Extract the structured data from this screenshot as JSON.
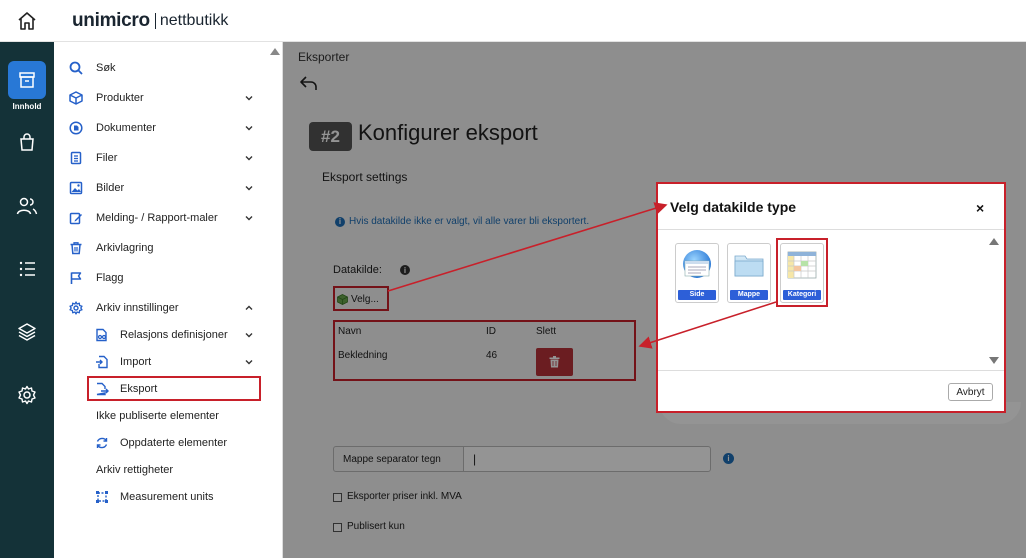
{
  "brand": {
    "name": "unimicro",
    "product": "nettbutikk"
  },
  "rail": {
    "active_label": "Innhold"
  },
  "sidenav": {
    "items": [
      {
        "label": "Søk"
      },
      {
        "label": "Produkter"
      },
      {
        "label": "Dokumenter"
      },
      {
        "label": "Filer"
      },
      {
        "label": "Bilder"
      },
      {
        "label": "Melding- / Rapport-maler"
      },
      {
        "label": "Arkivlagring"
      },
      {
        "label": "Flagg"
      },
      {
        "label": "Arkiv innstillinger"
      }
    ],
    "sub_items": [
      {
        "label": "Relasjons definisjoner"
      },
      {
        "label": "Import"
      },
      {
        "label": "Eksport"
      },
      {
        "label": "Ikke publiserte elementer"
      },
      {
        "label": "Oppdaterte elementer"
      },
      {
        "label": "Arkiv rettigheter"
      },
      {
        "label": "Measurement units"
      }
    ]
  },
  "main": {
    "breadcrumb": "Eksporter",
    "step": "#2",
    "title": "Konfigurer eksport",
    "section_title": "Eksport settings",
    "info_text": "Hvis datakilde ikke er valgt, vil alle varer bli eksportert.",
    "datasource_label": "Datakilde:",
    "velg_label": "Velg...",
    "table": {
      "headers": [
        "Navn",
        "ID",
        "Slett"
      ],
      "rows": [
        {
          "navn": "Bekledning",
          "id": "46"
        }
      ]
    },
    "separator_label": "Mappe separator tegn",
    "separator_value": "|",
    "checkbox_prices": "Eksporter priser inkl. MVA",
    "checkbox_published": "Publisert kun"
  },
  "dialog": {
    "title": "Velg datakilde type",
    "close": "×",
    "tiles": [
      {
        "label": "Side"
      },
      {
        "label": "Mappe"
      },
      {
        "label": "Kategori"
      }
    ],
    "cancel": "Avbryt"
  },
  "colors": {
    "accent": "#2878d6",
    "rail": "#143238",
    "highlight": "#c8202a",
    "danger": "#b8323a"
  }
}
